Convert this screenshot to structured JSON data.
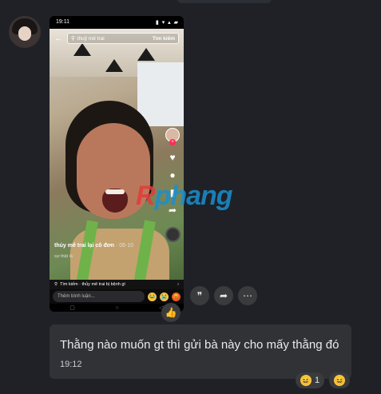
{
  "screenshot": {
    "status_time": "19:11",
    "status_icons": "▮ ▾ ▴ ▰",
    "search_query": "thuỷ mê trai",
    "search_button": "Tìm kiếm",
    "caption": "thủy mê trai lại cô đơn",
    "caption_date": "· 06-10",
    "sub_caption": "sự thật là",
    "related_search": "Tìm kiếm · thủy mê trai bị bệnh gì",
    "comment_placeholder": "Thêm bình luận...",
    "comment_emojis": [
      "😂",
      "😭",
      "😡"
    ],
    "nav_icons": [
      "▢",
      "○",
      "◁"
    ]
  },
  "watermark": {
    "first": "R",
    "rest": "phang"
  },
  "message": {
    "text": "Thằng nào muốn gt thì gửi bà này cho mấy thằng đó",
    "time": "19:12"
  },
  "reactions": [
    {
      "emoji": "😆",
      "count": "1"
    },
    {
      "emoji": "😆",
      "count": ""
    }
  ],
  "action_icons": {
    "react": "👍",
    "quote": "❞",
    "share": "➦",
    "more": "⋯"
  }
}
